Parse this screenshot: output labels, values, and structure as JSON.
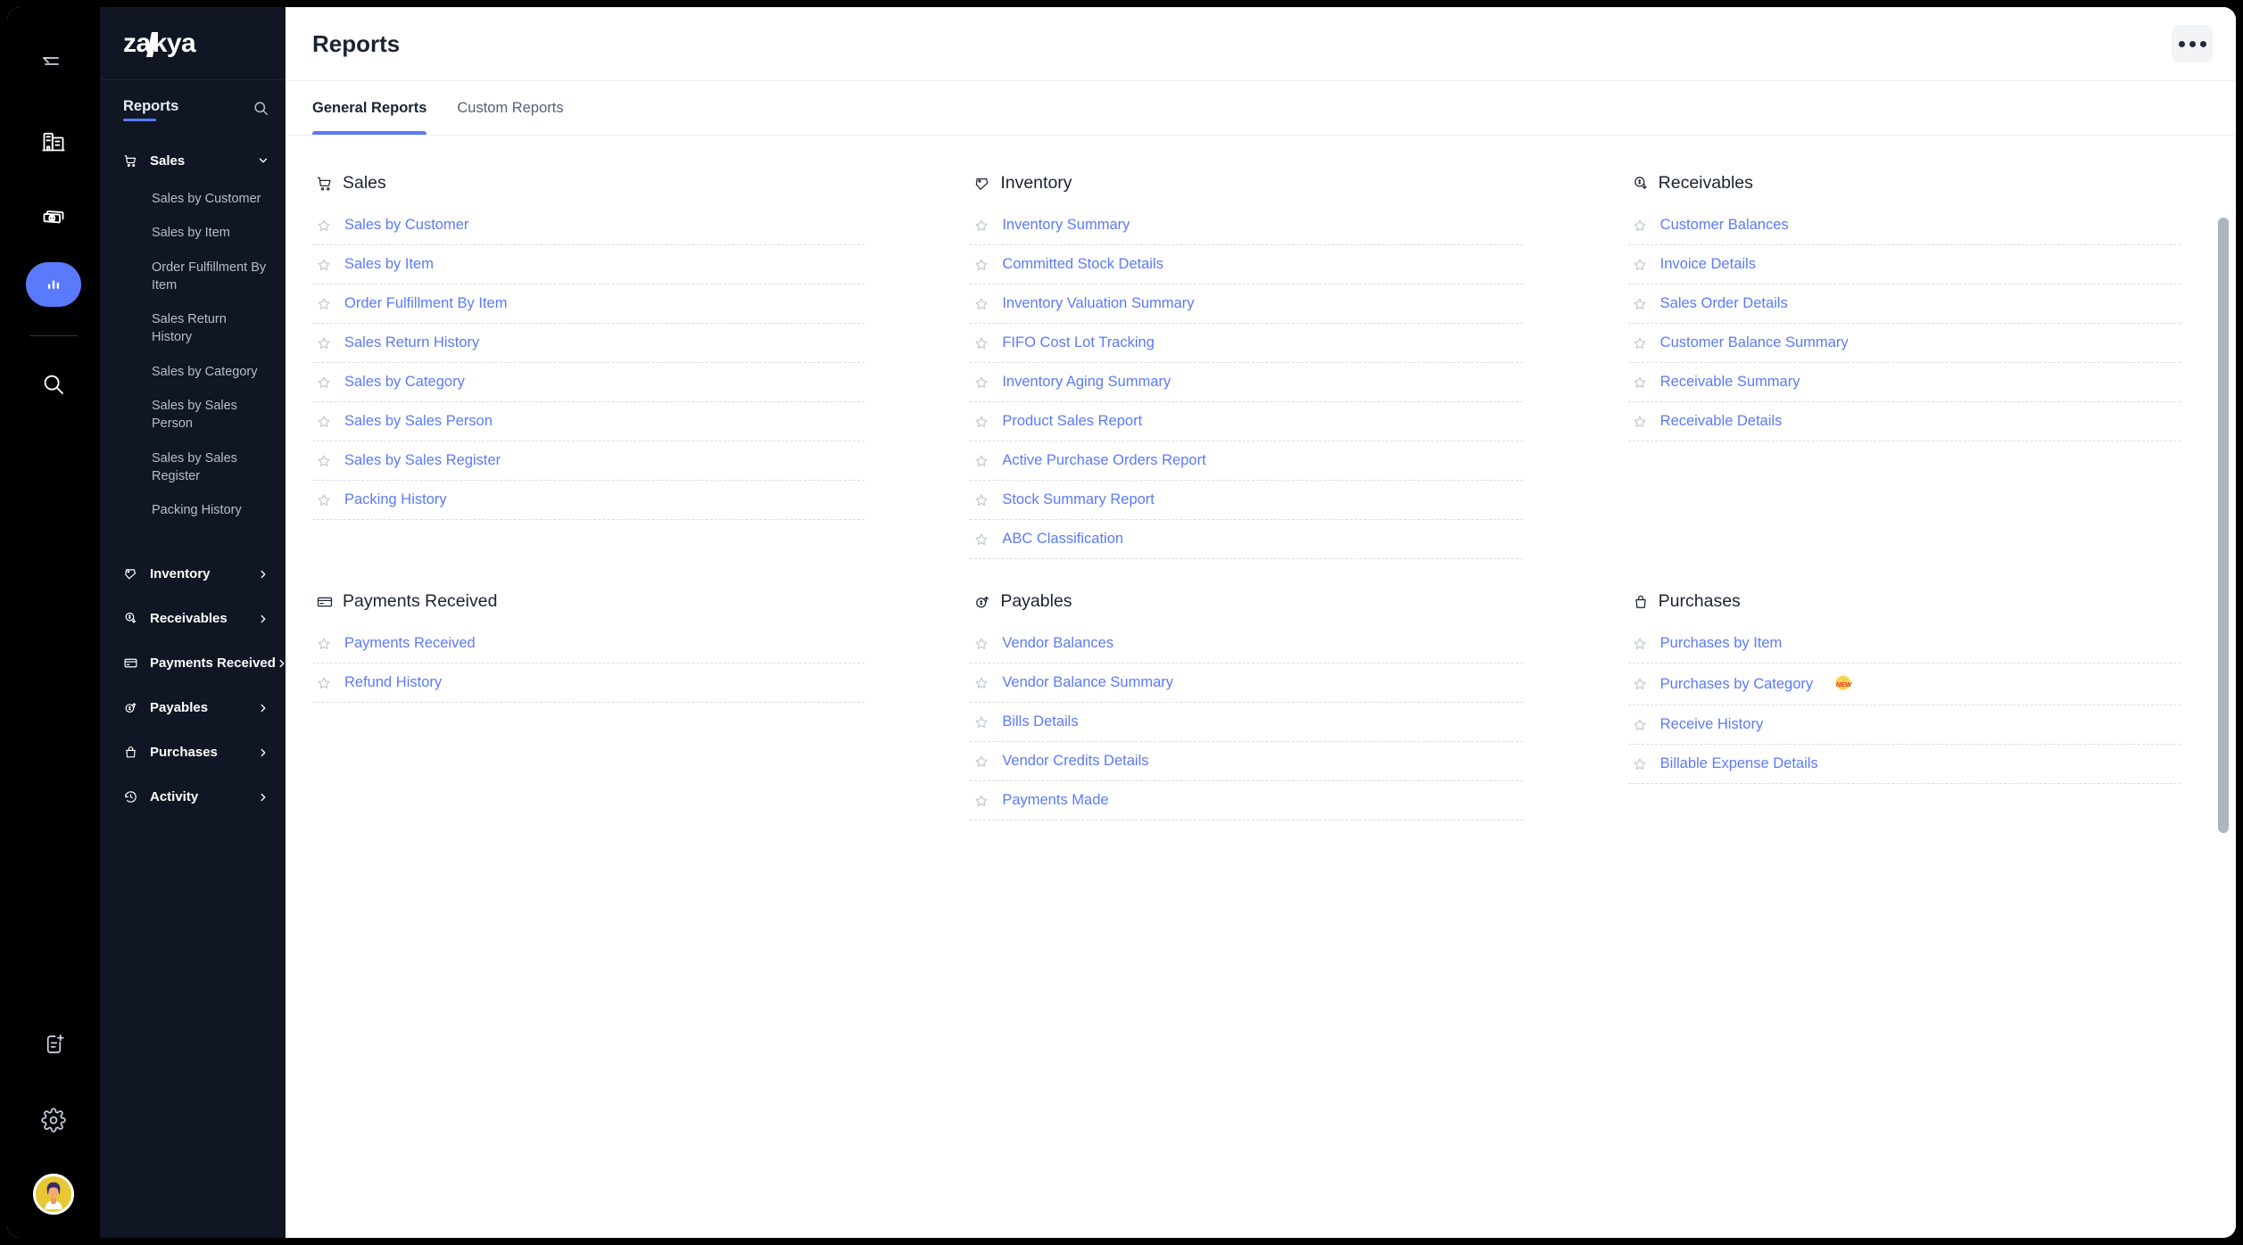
{
  "brand": {
    "name": "zakya",
    "pre": "za",
    "post": "kya"
  },
  "rail": {
    "items": [
      {
        "name": "collapse-sidebar",
        "icon": "arrow-left-collapse-icon"
      },
      {
        "name": "organization",
        "icon": "building-icon"
      },
      {
        "name": "sales-money",
        "icon": "money-stack-icon"
      },
      {
        "name": "reports",
        "icon": "bar-chart-icon",
        "active": true
      },
      {
        "name": "search",
        "icon": "search-icon"
      }
    ],
    "bottom": [
      {
        "name": "new-document",
        "icon": "document-plus-icon"
      },
      {
        "name": "settings",
        "icon": "gear-icon"
      },
      {
        "name": "user-profile",
        "icon": "avatar-icon"
      }
    ]
  },
  "sidebar": {
    "title": "Reports",
    "search_icon": "search-icon",
    "groups": [
      {
        "label": "Sales",
        "icon": "shopping-cart-icon",
        "expanded": true,
        "chevron": "chevron-down-icon",
        "items": [
          "Sales by Customer",
          "Sales by Item",
          "Order Fulfillment By Item",
          "Sales Return History",
          "Sales by Category",
          "Sales by Sales Person",
          "Sales by Sales Register",
          "Packing History"
        ]
      },
      {
        "label": "Inventory",
        "icon": "inventory-box-icon",
        "expanded": false,
        "chevron": "chevron-right-icon",
        "items": []
      },
      {
        "label": "Receivables",
        "icon": "coin-down-icon",
        "expanded": false,
        "chevron": "chevron-right-icon",
        "items": []
      },
      {
        "label": "Payments Received",
        "icon": "credit-card-icon",
        "expanded": false,
        "chevron": "chevron-right-icon",
        "items": []
      },
      {
        "label": "Payables",
        "icon": "coin-up-icon",
        "expanded": false,
        "chevron": "chevron-right-icon",
        "items": []
      },
      {
        "label": "Purchases",
        "icon": "bag-icon",
        "expanded": false,
        "chevron": "chevron-right-icon",
        "items": []
      },
      {
        "label": "Activity",
        "icon": "clock-history-icon",
        "expanded": false,
        "chevron": "chevron-right-icon",
        "items": []
      }
    ]
  },
  "header": {
    "title": "Reports",
    "more_button": {
      "name": "more-options-button",
      "icon": "ellipsis-icon"
    }
  },
  "tabs": [
    {
      "label": "General Reports",
      "active": true
    },
    {
      "label": "Custom Reports",
      "active": false
    }
  ],
  "sections": [
    {
      "title": "Sales",
      "icon": "shopping-cart-icon",
      "reports": [
        {
          "label": "Sales by Customer"
        },
        {
          "label": "Sales by Item"
        },
        {
          "label": "Order Fulfillment By Item"
        },
        {
          "label": "Sales Return History"
        },
        {
          "label": "Sales by Category"
        },
        {
          "label": "Sales by Sales Person"
        },
        {
          "label": "Sales by Sales Register"
        },
        {
          "label": "Packing History"
        }
      ]
    },
    {
      "title": "Inventory",
      "icon": "inventory-box-icon",
      "reports": [
        {
          "label": "Inventory Summary"
        },
        {
          "label": "Committed Stock Details"
        },
        {
          "label": "Inventory Valuation Summary"
        },
        {
          "label": "FIFO Cost Lot Tracking"
        },
        {
          "label": "Inventory Aging Summary"
        },
        {
          "label": "Product Sales Report"
        },
        {
          "label": "Active Purchase Orders Report"
        },
        {
          "label": "Stock Summary Report"
        },
        {
          "label": "ABC Classification"
        }
      ]
    },
    {
      "title": "Receivables",
      "icon": "coin-down-icon",
      "reports": [
        {
          "label": "Customer Balances"
        },
        {
          "label": "Invoice Details"
        },
        {
          "label": "Sales Order Details"
        },
        {
          "label": "Customer Balance Summary"
        },
        {
          "label": "Receivable Summary"
        },
        {
          "label": "Receivable Details"
        }
      ]
    },
    {
      "title": "Payments Received",
      "icon": "credit-card-icon",
      "reports": [
        {
          "label": "Payments Received"
        },
        {
          "label": "Refund History"
        }
      ]
    },
    {
      "title": "Payables",
      "icon": "coin-up-icon",
      "reports": [
        {
          "label": "Vendor Balances"
        },
        {
          "label": "Vendor Balance Summary"
        },
        {
          "label": "Bills Details"
        },
        {
          "label": "Vendor Credits Details"
        },
        {
          "label": "Payments Made"
        }
      ]
    },
    {
      "title": "Purchases",
      "icon": "bag-icon",
      "reports": [
        {
          "label": "Purchases by Item"
        },
        {
          "label": "Purchases by Category",
          "badge": "NEW"
        },
        {
          "label": "Receive History"
        },
        {
          "label": "Billable Expense Details"
        }
      ]
    }
  ],
  "colors": {
    "accent": "#5a7afc",
    "link": "#5a7afc",
    "sidebar_bg": "#101624",
    "rail_bg": "#000000",
    "page_bg": "#ffffff",
    "badge_bg": "#f5d44a",
    "badge_text": "#e03a2f",
    "scrollbar": "#aeb3c0"
  }
}
